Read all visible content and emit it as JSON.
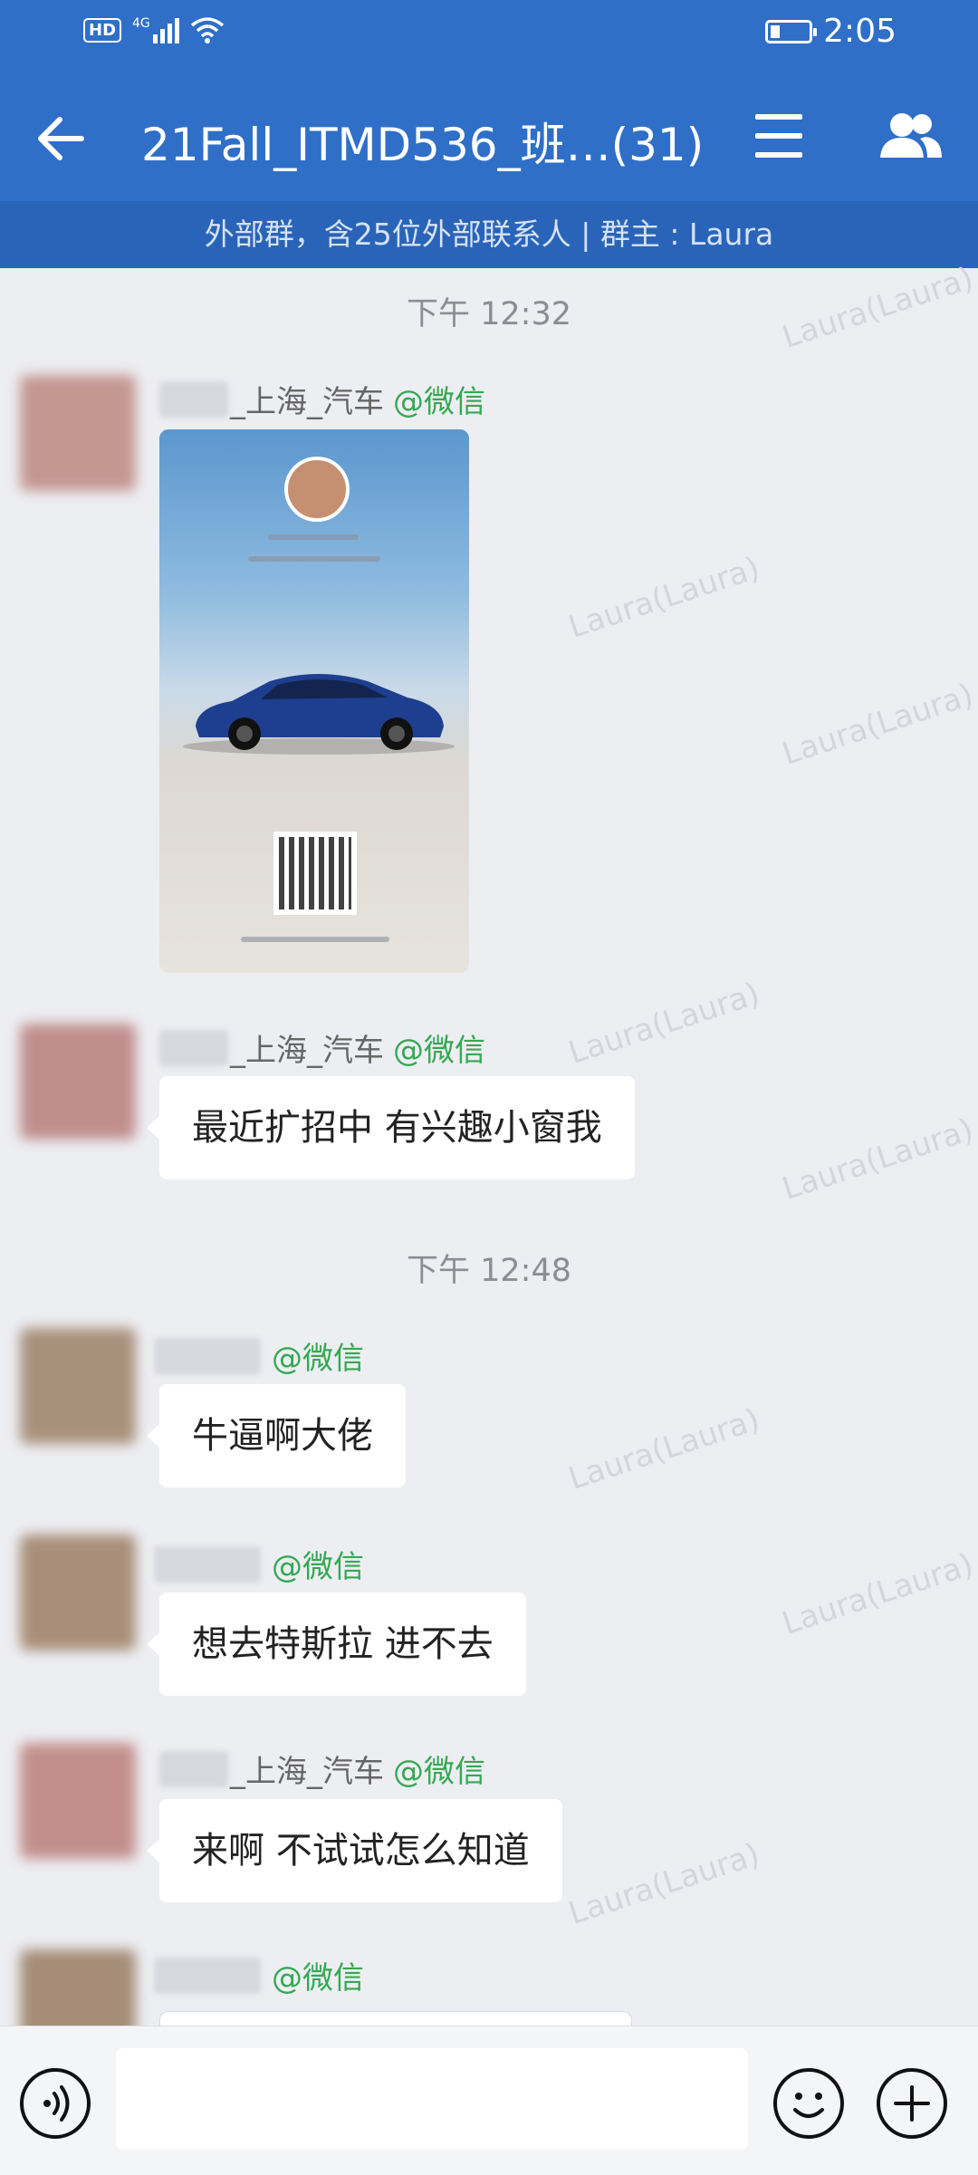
{
  "status": {
    "hd": "HD",
    "network": "4G",
    "time": "2:05"
  },
  "header": {
    "title": "21Fall_ITMD536_班…(31)",
    "group_info": "外部群，含25位外部联系人 | 群主 : Laura"
  },
  "watermark": "Laura(Laura)",
  "timestamps": [
    "下午 12:32",
    "下午 12:48"
  ],
  "messages": [
    {
      "sender": "_上海_汽车",
      "tag": "@微信",
      "type": "image"
    },
    {
      "sender": "_上海_汽车",
      "tag": "@微信",
      "text": "最近扩招中 有兴趣小窗我"
    },
    {
      "sender": "",
      "tag": "@微信",
      "text": "牛逼啊大佬"
    },
    {
      "sender": "",
      "tag": "@微信",
      "text": "想去特斯拉 进不去"
    },
    {
      "sender": "_上海_汽车",
      "tag": "@微信",
      "text": "来啊 不试试怎么知道"
    },
    {
      "sender": "",
      "tag": "@微信",
      "text": ""
    }
  ],
  "icons": {
    "back": "back-arrow-icon",
    "menu": "menu-icon",
    "members": "group-members-icon",
    "voice": "voice-icon",
    "emoji": "emoji-icon",
    "plus": "plus-icon"
  },
  "colors": {
    "header": "#2f6fc8",
    "subheader": "#2a64b8",
    "wechat_tag": "#34a853",
    "chat_bg": "#edeef2"
  }
}
